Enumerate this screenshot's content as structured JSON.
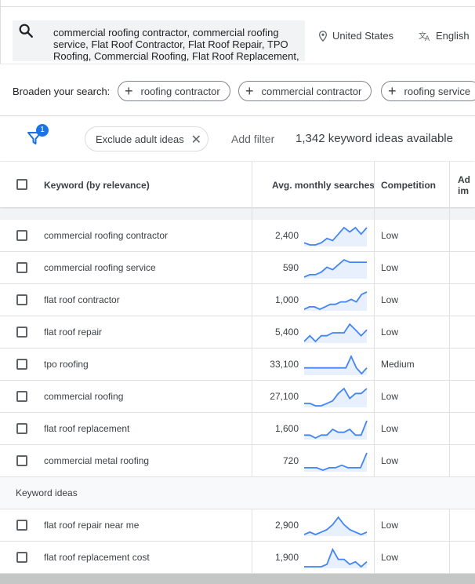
{
  "search": {
    "query": "commercial roofing contractor, commercial roofing service, Flat Roof Contractor, Flat Roof Repair, TPO Roofing, Commercial Roofing, Flat Roof Replacement,",
    "location": "United States",
    "language": "English"
  },
  "broaden": {
    "label": "Broaden your search:",
    "chips": [
      "roofing contractor",
      "commercial contractor",
      "roofing service"
    ]
  },
  "filters": {
    "badge_count": "1",
    "exclude_chip": "Exclude adult ideas",
    "add_filter": "Add filter",
    "ideas_available": "1,342 keyword ideas available"
  },
  "table": {
    "headers": {
      "keyword": "Keyword (by relevance)",
      "searches": "Avg. monthly searches",
      "competition": "Competition",
      "ad": "Ad im"
    },
    "provided_rows": [
      {
        "keyword": "commercial roofing contractor",
        "searches": "2,400",
        "competition": "Low",
        "trend": [
          3,
          2,
          2,
          3,
          5,
          4,
          7,
          10,
          8,
          10,
          7,
          10
        ]
      },
      {
        "keyword": "commercial roofing service",
        "searches": "590",
        "competition": "Low",
        "trend": [
          2,
          3,
          3,
          4,
          6,
          5,
          7,
          9,
          8,
          8,
          8,
          8
        ]
      },
      {
        "keyword": "flat roof contractor",
        "searches": "1,000",
        "competition": "Low",
        "trend": [
          3,
          4,
          4,
          3,
          4,
          5,
          5,
          6,
          6,
          7,
          6,
          9,
          10
        ]
      },
      {
        "keyword": "flat roof repair",
        "searches": "5,400",
        "competition": "Low",
        "trend": [
          2,
          4,
          2,
          4,
          4,
          5,
          5,
          5,
          8,
          6,
          4,
          6
        ]
      },
      {
        "keyword": "tpo roofing",
        "searches": "33,100",
        "competition": "Medium",
        "trend": [
          5,
          5,
          5,
          5,
          5,
          5,
          5,
          5,
          5,
          9,
          5,
          3,
          5
        ]
      },
      {
        "keyword": "commercial roofing",
        "searches": "27,100",
        "competition": "Low",
        "trend": [
          2,
          2,
          1,
          1,
          2,
          3,
          6,
          8,
          4,
          6,
          6,
          8
        ]
      },
      {
        "keyword": "flat roof replacement",
        "searches": "1,600",
        "competition": "Low",
        "trend": [
          2,
          2,
          1,
          2,
          2,
          4,
          3,
          3,
          4,
          2,
          2,
          7
        ]
      },
      {
        "keyword": "commercial metal roofing",
        "searches": "720",
        "competition": "Low",
        "trend": [
          2,
          2,
          2,
          1,
          2,
          2,
          3,
          2,
          2,
          2,
          8
        ]
      }
    ],
    "section_label": "Keyword ideas",
    "idea_rows": [
      {
        "keyword": "flat roof repair near me",
        "searches": "2,900",
        "competition": "Low",
        "trend": [
          3,
          4,
          3,
          4,
          5,
          7,
          10,
          7,
          5,
          4,
          3,
          4
        ]
      },
      {
        "keyword": "flat roof replacement cost",
        "searches": "1,900",
        "competition": "Low",
        "trend": [
          2,
          2,
          2,
          2,
          3,
          9,
          5,
          5,
          3,
          4,
          2,
          4
        ]
      }
    ]
  },
  "colors": {
    "accent": "#1a73e8",
    "spark": "#4285f4",
    "spark_fill": "#e8f0fe"
  }
}
